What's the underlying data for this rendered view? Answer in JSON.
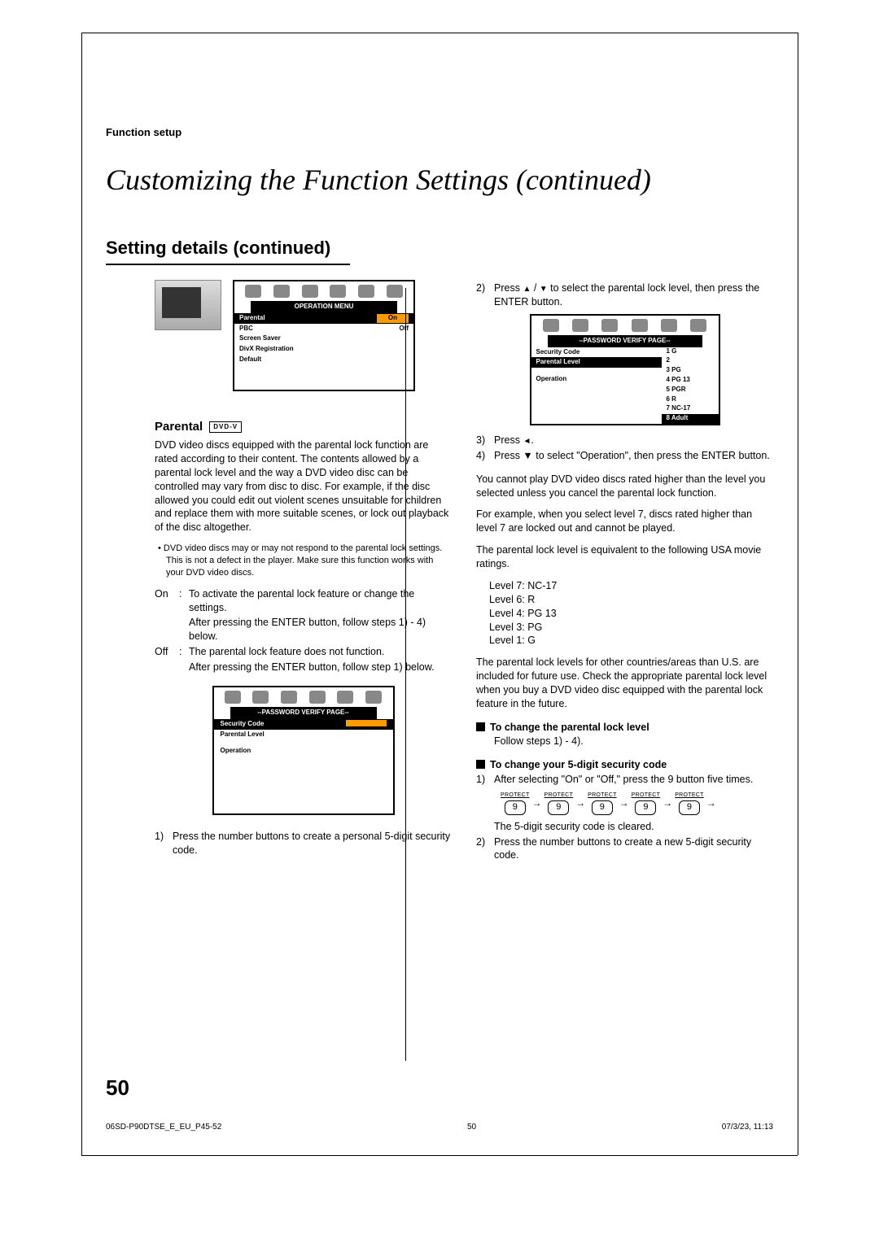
{
  "header": {
    "section_label": "Function setup"
  },
  "title": "Customizing the Function Settings (continued)",
  "subheading": "Setting details (continued)",
  "left": {
    "op_menu": {
      "icon_row_count": 6,
      "title": "OPERATION MENU",
      "rows": [
        {
          "label": "Parental",
          "value": "On",
          "highlight": true
        },
        {
          "label": "PBC",
          "value": "Off"
        },
        {
          "label": "Screen Saver",
          "value": ""
        },
        {
          "label": "DivX Registration",
          "value": ""
        },
        {
          "label": "Default",
          "value": ""
        }
      ]
    },
    "section_title": "Parental",
    "dvd_badge": "DVD-V",
    "para1": "DVD video discs equipped with the parental lock function are rated according to their content. The contents allowed by a parental lock level and the way a DVD video disc can be controlled may vary from disc to disc. For example, if the disc allowed you could edit out violent scenes unsuitable for children and replace them with more suitable scenes, or lock out playback of the disc altogether.",
    "note_bullet": "• DVD video discs may or may not respond to the parental lock settings. This is not a defect in the player. Make sure this function works with your DVD video discs.",
    "on_label": "On",
    "on_text1": "To activate the parental lock feature or change the settings.",
    "on_text2": "After pressing the ENTER button, follow steps 1) - 4) below.",
    "off_label": "Off",
    "off_text1": "The parental lock feature does not function.",
    "off_text2": "After pressing the ENTER button, follow step 1) below.",
    "pw_box": {
      "title": "--PASSWORD VERIFY PAGE--",
      "rows": [
        {
          "label": "Security Code",
          "highlight": true,
          "field": true
        },
        {
          "label": "Parental Level"
        },
        {
          "label": "Operation"
        }
      ]
    },
    "step1_n": "1)",
    "step1_t": "Press the number buttons to create a personal 5-digit security code."
  },
  "right": {
    "step2_n": "2)",
    "step2_t_a": "Press ",
    "step2_t_b": " / ",
    "step2_t_c": " to select the parental lock level, then press the ENTER button.",
    "levels_box": {
      "title": "--PASSWORD VERIFY PAGE--",
      "left_rows": [
        {
          "label": "Security Code"
        },
        {
          "label": "Parental Level",
          "highlight": true
        },
        {
          "label": ""
        },
        {
          "label": "Operation"
        }
      ],
      "right_rows": [
        "1  G",
        "2",
        "3  PG",
        "4  PG  13",
        "5  PGR",
        "6  R",
        "7  NC-17"
      ],
      "right_last": "8  Adult"
    },
    "step3_n": "3)",
    "step3_t_a": "Press ",
    "step3_t_b": ".",
    "step4_n": "4)",
    "step4_t": "Press ▼ to select \"Operation\", then press the ENTER button.",
    "para_a": "You cannot play DVD video discs rated higher than the level you selected unless you cancel the parental lock function.",
    "para_b": "For example, when you select level 7, discs rated higher than level 7 are locked out and cannot be played.",
    "para_c": "The parental lock level is equivalent to the following USA movie ratings.",
    "ratings": [
      "Level 7: NC-17",
      "Level 6: R",
      "Level 4: PG 13",
      "Level 3: PG",
      "Level 1: G"
    ],
    "para_d": "The parental lock levels for other countries/areas than U.S. are included for future use. Check the appropriate parental lock level when you buy a DVD video disc equipped with the parental lock feature in the future.",
    "sub1_title": "To change the parental lock level",
    "sub1_text": "Follow steps 1) - 4).",
    "sub2_title": "To change your 5-digit security code",
    "sub2_step1_n": "1)",
    "sub2_step1_t": "After selecting \"On\" or \"Off,\" press the 9 button five times.",
    "protect_label": "PROTECT",
    "digit": "9",
    "sub2_line": "The 5-digit security code is cleared.",
    "sub2_step2_n": "2)",
    "sub2_step2_t": "Press the number buttons to create a new 5-digit security code."
  },
  "page_number": "50",
  "footer": {
    "left": "06SD-P90DTSE_E_EU_P45-52",
    "center": "50",
    "right": "07/3/23, 11:13"
  }
}
